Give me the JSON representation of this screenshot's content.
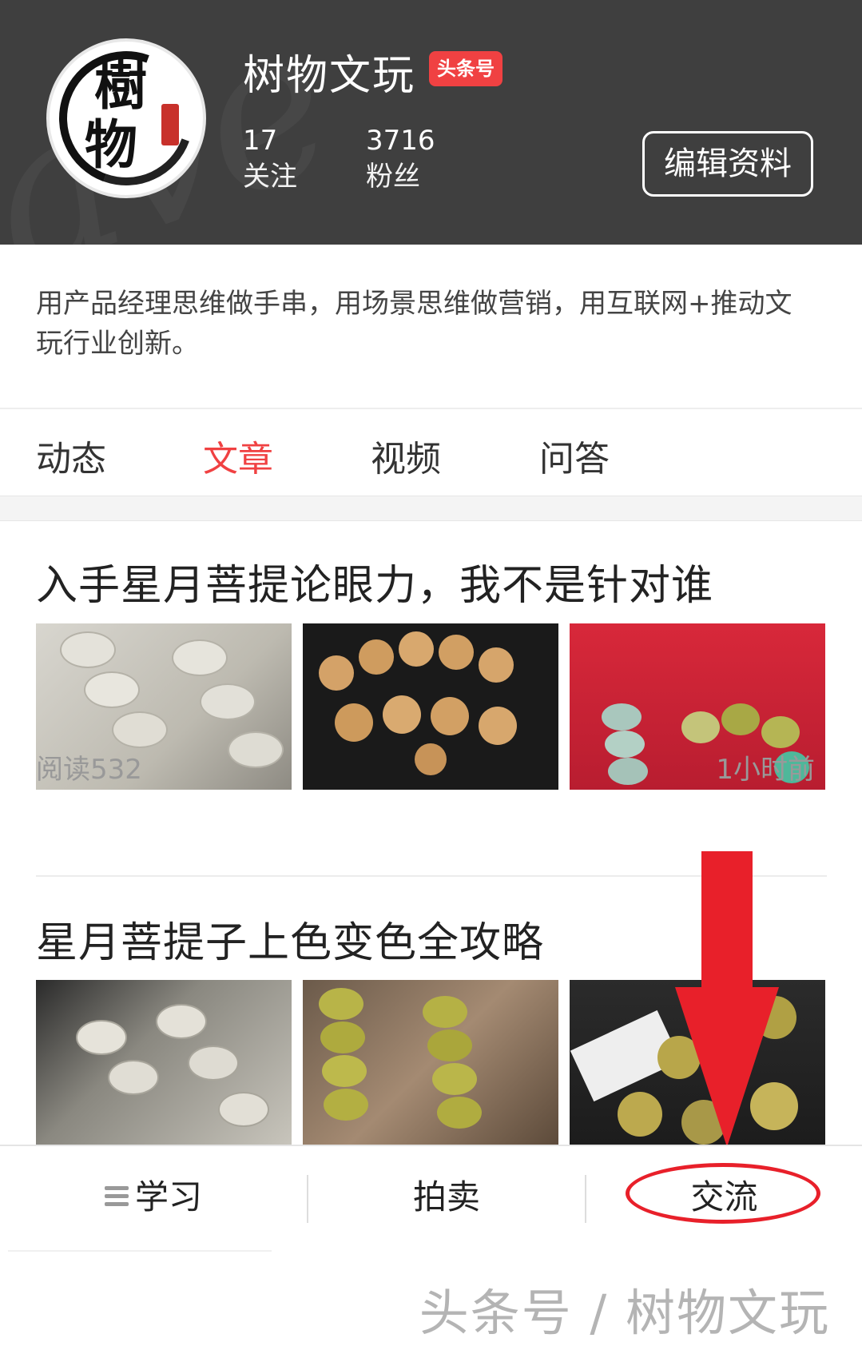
{
  "profile": {
    "name": "树物文玩",
    "badge": "头条号",
    "avatar_text_top": "樹",
    "avatar_text_bottom": "物",
    "following_count": "17",
    "following_label": "关注",
    "fans_count": "3716",
    "fans_label": "粉丝",
    "edit_label": "编辑资料",
    "bio": "用产品经理思维做手串，用场景思维做营销，用互联网+推动文玩行业创新。"
  },
  "tabs": [
    {
      "label": "动态",
      "active": false
    },
    {
      "label": "文章",
      "active": true
    },
    {
      "label": "视频",
      "active": false
    },
    {
      "label": "问答",
      "active": false
    }
  ],
  "articles": [
    {
      "title": "入手星月菩提论眼力，我不是针对谁",
      "reads": "阅读532",
      "time": "1小时前"
    },
    {
      "title": "星月菩提子上色变色全攻略"
    }
  ],
  "bottom_nav": [
    {
      "label": "学习",
      "icon": "menu-icon"
    },
    {
      "label": "拍卖"
    },
    {
      "label": "交流"
    }
  ],
  "footer_watermark": "头条号 / 树物文玩",
  "colors": {
    "header_bg": "#3f3f3f",
    "accent": "#f04142",
    "annotation_red": "#e8202a"
  }
}
